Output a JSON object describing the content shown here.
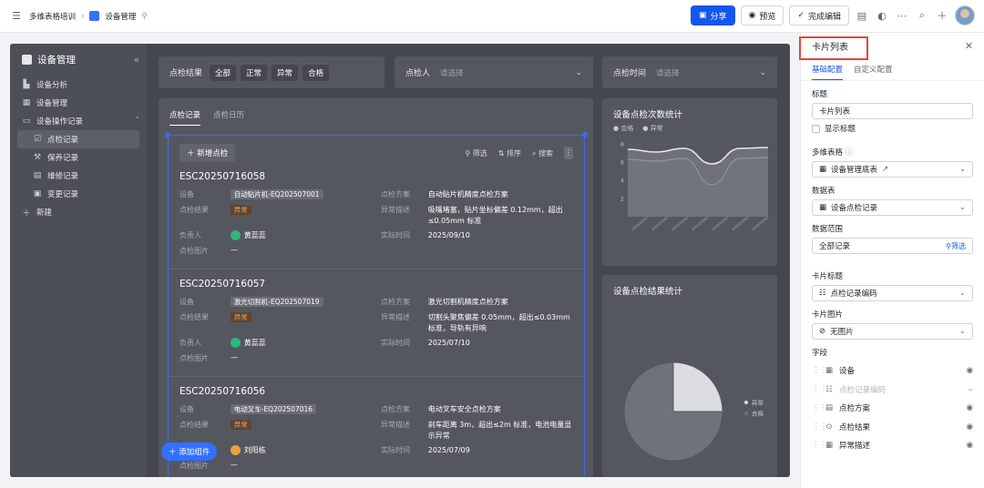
{
  "topbar": {
    "doc_title": "多维表格培训",
    "page_title": "设备管理",
    "share": "分享",
    "preview": "预览",
    "finish_edit": "完成编辑"
  },
  "sidebar": {
    "title": "设备管理",
    "items": [
      {
        "label": "设备分析",
        "icon": "chart-icon"
      },
      {
        "label": "设备管理",
        "icon": "grid-icon"
      },
      {
        "label": "设备操作记录",
        "icon": "folder-icon"
      },
      {
        "label": "点检记录",
        "icon": "check-icon"
      },
      {
        "label": "保养记录",
        "icon": "wrench-icon"
      },
      {
        "label": "维修记录",
        "icon": "doc-icon"
      },
      {
        "label": "变更记录",
        "icon": "calendar-icon"
      },
      {
        "label": "新建",
        "icon": "plus-icon"
      }
    ]
  },
  "filters": {
    "result_label": "点检结果",
    "result_chips": [
      "全部",
      "正常",
      "异常",
      "合格"
    ],
    "person_label": "点检人",
    "person_placeholder": "请选择",
    "time_label": "点检时间",
    "time_placeholder": "请选择"
  },
  "list_panel": {
    "tabs": [
      "点检记录",
      "点检日历"
    ],
    "new_button": "新增点检",
    "tools": [
      "筛选",
      "排序",
      "搜索"
    ],
    "cards": [
      {
        "code": "ESC20250716058",
        "device_label": "设备",
        "device": "自动贴片机-EQ202507001",
        "plan_label": "点检方案",
        "plan": "自动贴片机精度点检方案",
        "result_label": "点检结果",
        "result": "异常",
        "desc_label": "异常描述",
        "desc": "吸嘴堵塞，贴片坐标偏差 0.12mm，超出≤0.05mm 标准",
        "owner_label": "负责人",
        "owner": "黄蕊蕊",
        "owner_avatar": "黄蕊",
        "time_label": "实际时间",
        "time": "2025/09/10",
        "image_label": "点检图片",
        "image": "—"
      },
      {
        "code": "ESC20250716057",
        "device_label": "设备",
        "device": "激光切割机-EQ202507019",
        "plan_label": "点检方案",
        "plan": "激光切割机精度点检方案",
        "result_label": "点检结果",
        "result": "异常",
        "desc_label": "异常描述",
        "desc": "切割头聚焦偏差 0.05mm，超出≤0.03mm 标准，导轨有异响",
        "owner_label": "负责人",
        "owner": "黄蕊蕊",
        "owner_avatar": "黄蕊",
        "time_label": "实际时间",
        "time": "2025/07/10",
        "image_label": "点检图片",
        "image": "—"
      },
      {
        "code": "ESC20250716056",
        "device_label": "设备",
        "device": "电动叉车-EQ202507016",
        "plan_label": "点检方案",
        "plan": "电动叉车安全点检方案",
        "result_label": "点检结果",
        "result": "异常",
        "desc_label": "异常描述",
        "desc": "刹车距离 3m，超出≤2m 标准，电池电量显示异常",
        "owner_label": "负责人",
        "owner": "刘阳栋",
        "owner_avatar": "刘",
        "time_label": "实际时间",
        "time": "2025/07/09",
        "image_label": "点检图片",
        "image": "—"
      }
    ],
    "add_component": "添加组件"
  },
  "stat_count": {
    "title": "设备点检次数统计",
    "legend": [
      "合格",
      "异常"
    ]
  },
  "stat_result": {
    "title": "设备点检结果统计",
    "legend": [
      "异常",
      "合格"
    ]
  },
  "chart_data": [
    {
      "type": "area",
      "title": "设备点检次数统计",
      "ylim": [
        0,
        8
      ],
      "y_ticks": [
        2,
        4,
        6,
        8
      ],
      "x": [
        0,
        1,
        2,
        3,
        4,
        5
      ],
      "series": [
        {
          "name": "合格",
          "values": [
            7.4,
            7.1,
            7.5,
            5.8,
            7.5,
            7.6
          ]
        },
        {
          "name": "异常",
          "values": [
            6.3,
            6.1,
            6.4,
            3.5,
            6.4,
            6.5
          ]
        }
      ],
      "colors": {
        "合格": "#e6e7ea",
        "异常": "#8f939b"
      }
    },
    {
      "type": "pie",
      "title": "设备点检结果统计",
      "categories": [
        "异常",
        "合格"
      ],
      "values": [
        25,
        75
      ],
      "colors": [
        "#dcdde1",
        "#6e727c"
      ]
    }
  ],
  "right_panel": {
    "title": "卡片列表",
    "tabs": [
      "基础配置",
      "自定义配置"
    ],
    "title_label": "标题",
    "title_value": "卡片列表",
    "show_title": "显示标题",
    "base_label": "多维表格",
    "base_value": "设备管理底表",
    "table_label": "数据表",
    "table_value": "设备点检记录",
    "range_label": "数据范围",
    "range_value": "全部记录",
    "range_filter": "筛选",
    "card_title_label": "卡片标题",
    "card_title_value": "点检记录编码",
    "card_image_label": "卡片图片",
    "card_image_value": "无图片",
    "fields_label": "字段",
    "fields": [
      {
        "label": "设备",
        "visible": true
      },
      {
        "label": "点检记录编码",
        "visible": false
      },
      {
        "label": "点检方案",
        "visible": true
      },
      {
        "label": "点检结果",
        "visible": true
      },
      {
        "label": "异常描述",
        "visible": true
      }
    ]
  }
}
